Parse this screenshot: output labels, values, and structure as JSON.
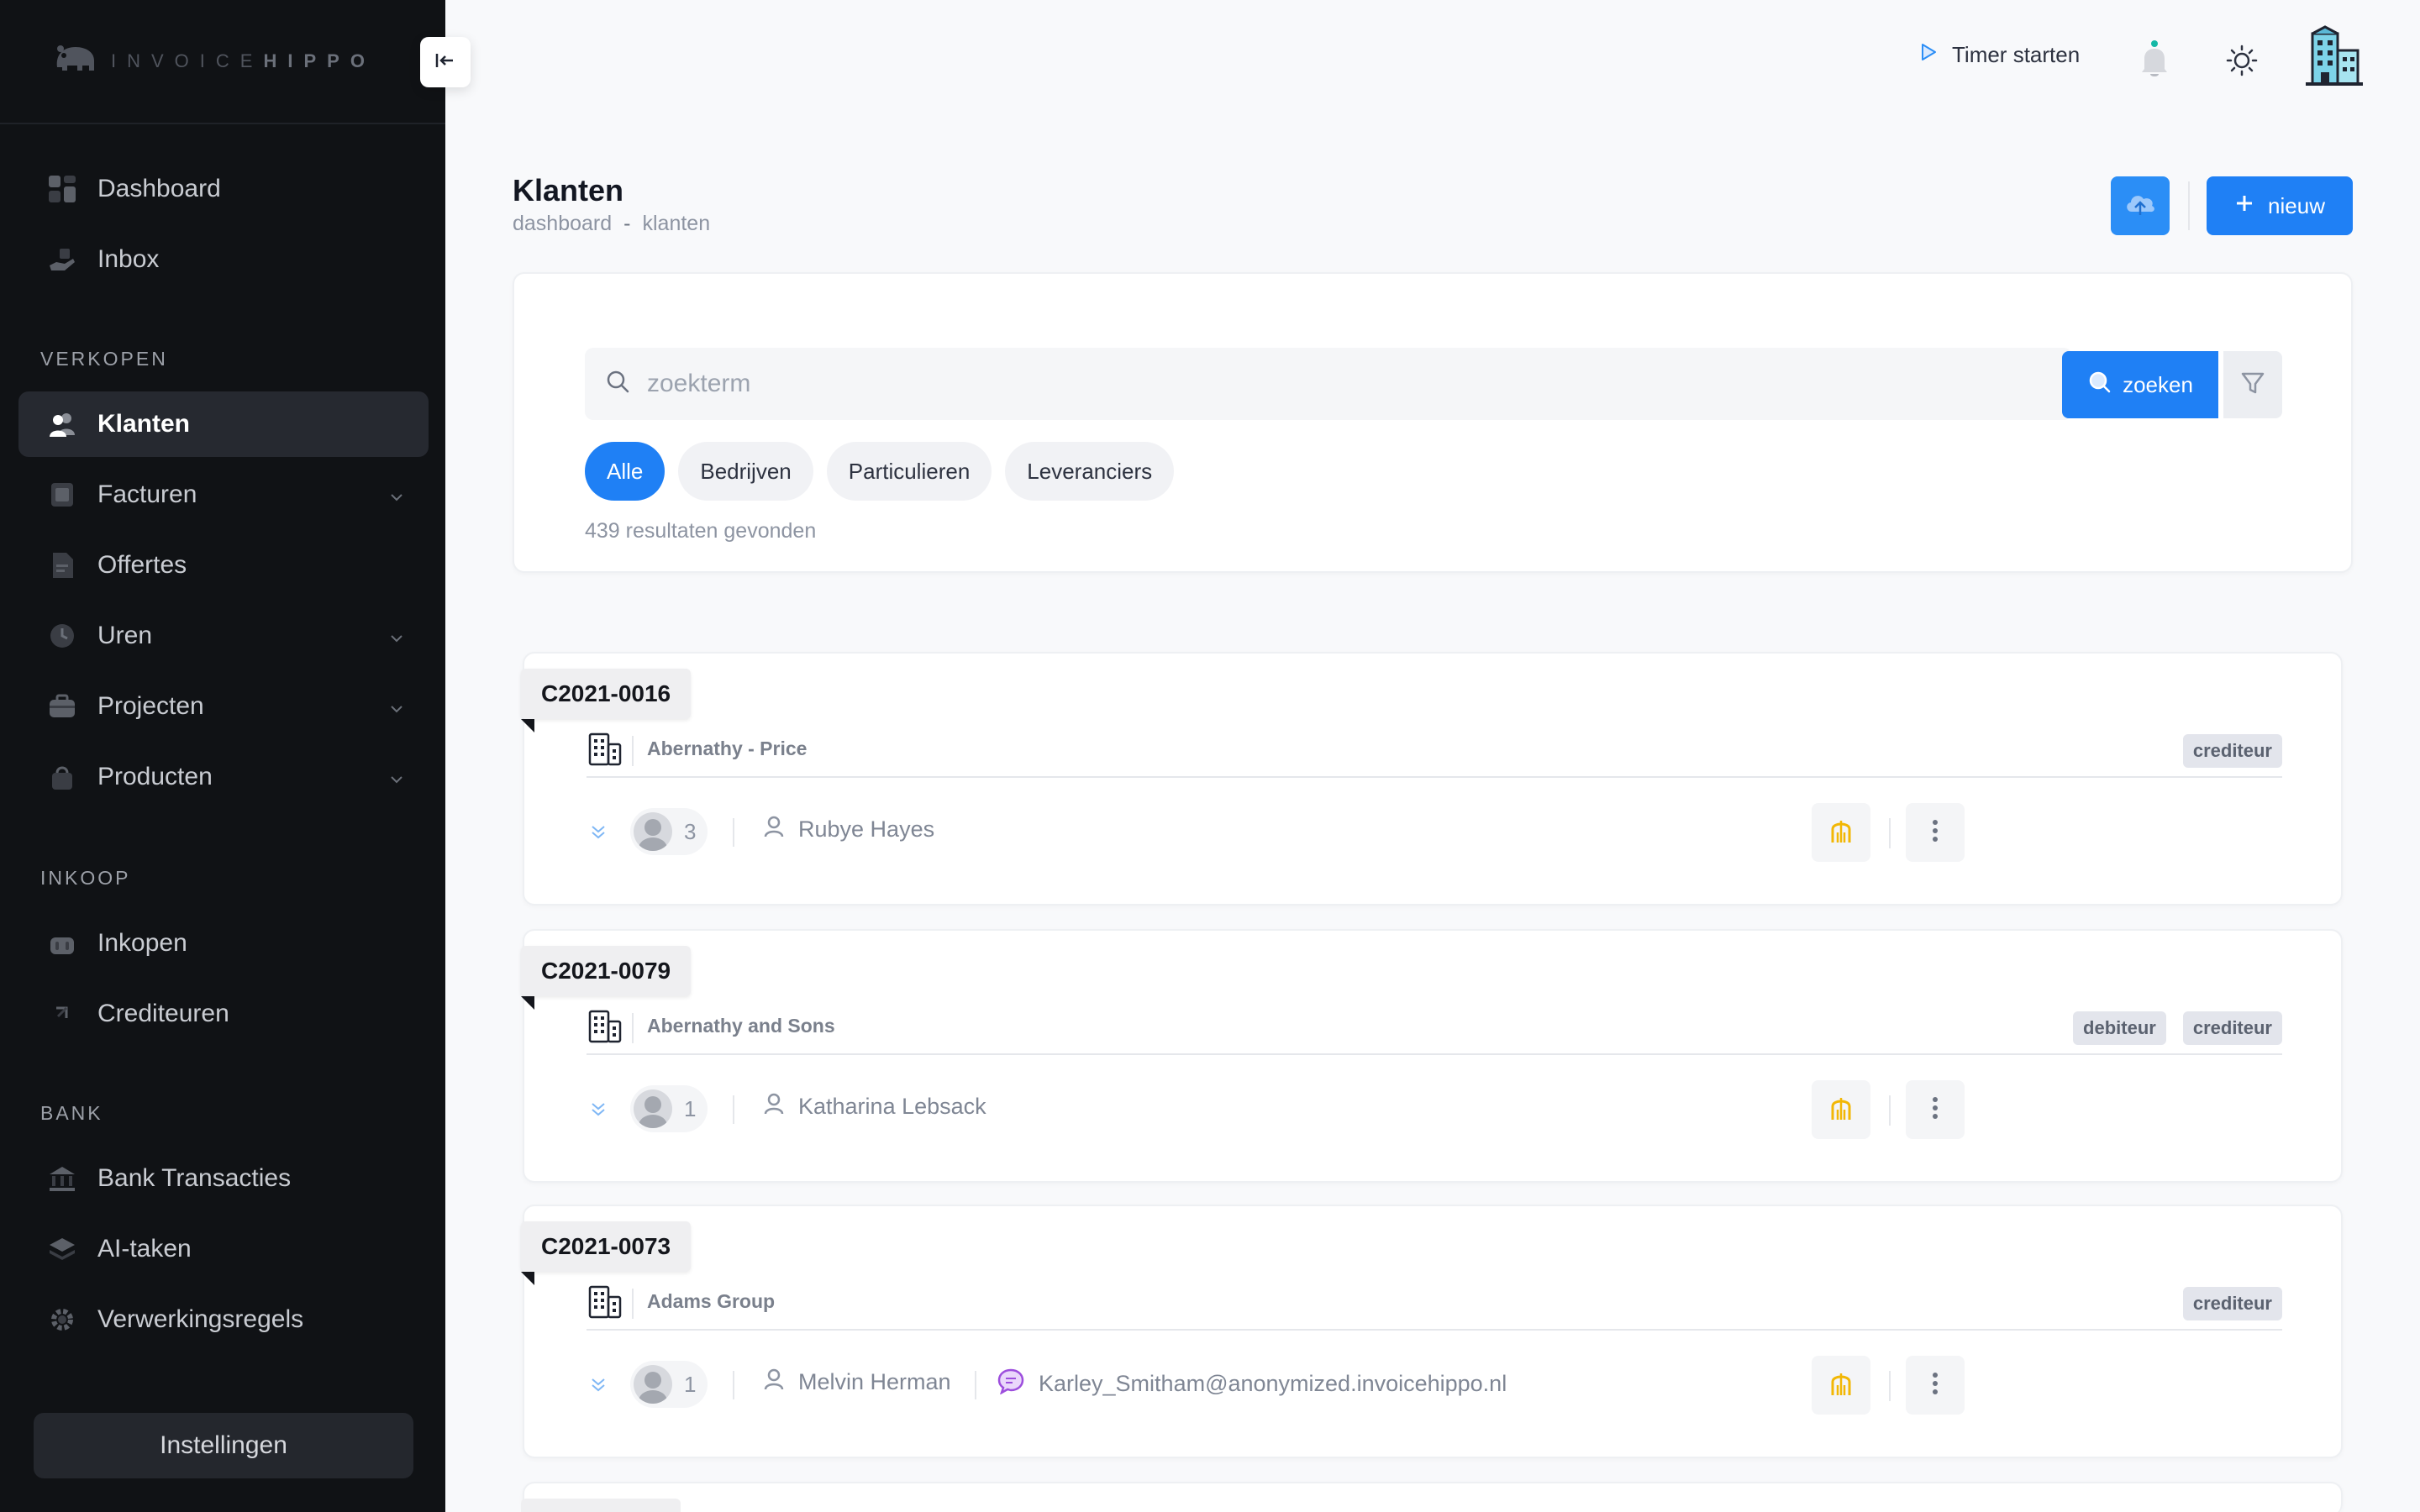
{
  "brand": {
    "logo_left": "INVOICE",
    "logo_right": "HIPPO"
  },
  "sidebar": {
    "main_items": [
      {
        "label": "Dashboard",
        "icon": "dashboard-icon"
      },
      {
        "label": "Inbox",
        "icon": "inbox-icon"
      }
    ],
    "sections": [
      {
        "label": "VERKOPEN"
      },
      {
        "label": "INKOOP"
      },
      {
        "label": "BANK"
      }
    ],
    "verkopen_items": [
      {
        "label": "Klanten",
        "active": true
      },
      {
        "label": "Facturen",
        "has_submenu": true
      },
      {
        "label": "Offertes"
      },
      {
        "label": "Uren",
        "has_submenu": true
      },
      {
        "label": "Projecten",
        "has_submenu": true
      },
      {
        "label": "Producten",
        "has_submenu": true
      }
    ],
    "inkoop_items": [
      {
        "label": "Inkopen"
      },
      {
        "label": "Crediteuren"
      }
    ],
    "bank_items": [
      {
        "label": "Bank Transacties"
      },
      {
        "label": "AI-taken"
      },
      {
        "label": "Verwerkingsregels"
      }
    ],
    "settings_label": "Instellingen"
  },
  "topbar": {
    "timer_label": "Timer starten"
  },
  "page": {
    "title": "Klanten",
    "breadcrumb": [
      "dashboard",
      "klanten"
    ],
    "breadcrumb_sep": "-",
    "new_label": "nieuw"
  },
  "search": {
    "placeholder": "zoekterm",
    "button_label": "zoeken",
    "filters": [
      "Alle",
      "Bedrijven",
      "Particulieren",
      "Leveranciers"
    ],
    "active_filter": "Alle",
    "result_count": "439 resultaten gevonden"
  },
  "customers": [
    {
      "code": "C2021-0016",
      "name": "Abernathy - Price",
      "badges": [
        "crediteur"
      ],
      "contacts": "3",
      "person": "Rubye Hayes",
      "email": ""
    },
    {
      "code": "C2021-0079",
      "name": "Abernathy and Sons",
      "badges": [
        "debiteur",
        "crediteur"
      ],
      "contacts": "1",
      "person": "Katharina Lebsack",
      "email": ""
    },
    {
      "code": "C2021-0073",
      "name": "Adams Group",
      "badges": [
        "crediteur"
      ],
      "contacts": "1",
      "person": "Melvin Herman",
      "email": "Karley_Smitham@anonymized.invoicehippo.nl"
    }
  ],
  "colors": {
    "primary": "#1f80f5",
    "sidebar_bg": "#101215",
    "accent_yellow": "#f2b705",
    "accent_teal": "#14b8a6"
  }
}
